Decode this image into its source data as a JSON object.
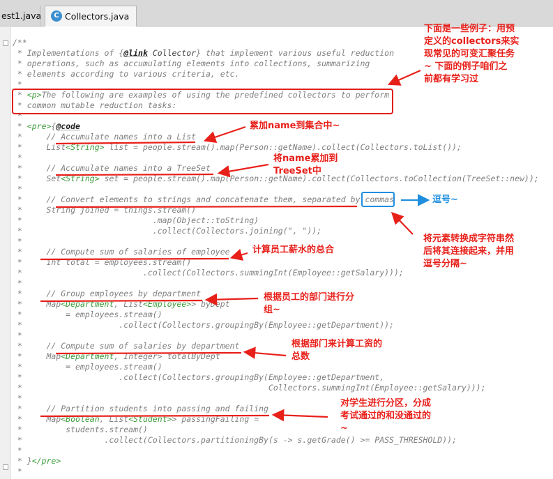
{
  "tabs": [
    {
      "label": "est1.java"
    },
    {
      "label": "Collectors.java",
      "icon": "C"
    }
  ],
  "code_lines": [
    {
      "id": 0,
      "parts": [
        {
          "t": "/**"
        }
      ]
    },
    {
      "id": 1,
      "parts": [
        {
          "t": " * Implementations of {"
        },
        {
          "t": "@link",
          "c": "kw"
        },
        {
          "t": " Collector",
          "c": "ref"
        },
        {
          "t": "} that implement various useful reduction"
        }
      ]
    },
    {
      "id": 2,
      "parts": [
        {
          "t": " * operations, such as accumulating elements into collections, summarizing"
        }
      ]
    },
    {
      "id": 3,
      "parts": [
        {
          "t": " * elements according to various criteria, etc."
        }
      ]
    },
    {
      "id": 4,
      "parts": [
        {
          "t": " *"
        }
      ]
    },
    {
      "id": 5,
      "parts": [
        {
          "t": " * "
        },
        {
          "t": "<p>",
          "c": "tag"
        },
        {
          "t": "The following are examples of using the predefined collectors to perform"
        }
      ]
    },
    {
      "id": 6,
      "parts": [
        {
          "t": " * common mutable reduction tasks:"
        }
      ]
    },
    {
      "id": 7,
      "parts": [
        {
          "t": " *"
        }
      ]
    },
    {
      "id": 8,
      "parts": [
        {
          "t": " * "
        },
        {
          "t": "<pre>",
          "c": "tag"
        },
        {
          "t": "{"
        },
        {
          "t": "@code",
          "c": "kw"
        }
      ]
    },
    {
      "id": 9,
      "parts": [
        {
          "t": " *     // Accumulate names into a List"
        }
      ]
    },
    {
      "id": 10,
      "parts": [
        {
          "t": " *     List"
        },
        {
          "t": "<String>",
          "c": "tag"
        },
        {
          "t": " list = people.stream().map(Person::getName).collect(Collectors.toList());"
        }
      ]
    },
    {
      "id": 11,
      "parts": [
        {
          "t": " *"
        }
      ]
    },
    {
      "id": 12,
      "parts": [
        {
          "t": " *     // Accumulate names into a TreeSet"
        }
      ]
    },
    {
      "id": 13,
      "parts": [
        {
          "t": " *     Set"
        },
        {
          "t": "<String>",
          "c": "tag"
        },
        {
          "t": " set = people.stream().map(Person::getName).collect(Collectors.toCollection(TreeSet::new));"
        }
      ]
    },
    {
      "id": 14,
      "parts": [
        {
          "t": " *"
        }
      ]
    },
    {
      "id": 15,
      "parts": [
        {
          "t": " *     // Convert elements to strings and concatenate them, separated by commas"
        }
      ]
    },
    {
      "id": 16,
      "parts": [
        {
          "t": " *     String joined = things.stream()"
        }
      ]
    },
    {
      "id": 17,
      "parts": [
        {
          "t": " *                           .map(Object::toString)"
        }
      ]
    },
    {
      "id": 18,
      "parts": [
        {
          "t": " *                           .collect(Collectors.joining(\", \"));"
        }
      ]
    },
    {
      "id": 19,
      "parts": [
        {
          "t": " *"
        }
      ]
    },
    {
      "id": 20,
      "parts": [
        {
          "t": " *     // Compute sum of salaries of employee"
        }
      ]
    },
    {
      "id": 21,
      "parts": [
        {
          "t": " *     int total = employees.stream()"
        }
      ]
    },
    {
      "id": 22,
      "parts": [
        {
          "t": " *                         .collect(Collectors.summingInt(Employee::getSalary)));"
        }
      ]
    },
    {
      "id": 23,
      "parts": [
        {
          "t": " *"
        }
      ]
    },
    {
      "id": 24,
      "parts": [
        {
          "t": " *     // Group employees by department"
        }
      ]
    },
    {
      "id": 25,
      "parts": [
        {
          "t": " *     Map"
        },
        {
          "t": "<Department",
          "c": "tag"
        },
        {
          "t": ", List"
        },
        {
          "t": "<Employee>",
          "c": "tag"
        },
        {
          "t": "> byDept"
        }
      ]
    },
    {
      "id": 26,
      "parts": [
        {
          "t": " *         = employees.stream()"
        }
      ]
    },
    {
      "id": 27,
      "parts": [
        {
          "t": " *                    .collect(Collectors.groupingBy(Employee::getDepartment));"
        }
      ]
    },
    {
      "id": 28,
      "parts": [
        {
          "t": " *"
        }
      ]
    },
    {
      "id": 29,
      "parts": [
        {
          "t": " *     // Compute sum of salaries by department"
        }
      ]
    },
    {
      "id": 30,
      "parts": [
        {
          "t": " *     Map"
        },
        {
          "t": "<Department",
          "c": "tag"
        },
        {
          "t": ", Integer> totalByDept"
        }
      ]
    },
    {
      "id": 31,
      "parts": [
        {
          "t": " *         = employees.stream()"
        }
      ]
    },
    {
      "id": 32,
      "parts": [
        {
          "t": " *                    .collect(Collectors.groupingBy(Employee::getDepartment,"
        }
      ]
    },
    {
      "id": 33,
      "parts": [
        {
          "t": " *                                                   Collectors.summingInt(Employee::getSalary)));"
        }
      ]
    },
    {
      "id": 34,
      "parts": [
        {
          "t": " *"
        }
      ]
    },
    {
      "id": 35,
      "parts": [
        {
          "t": " *     // Partition students into passing and failing"
        }
      ]
    },
    {
      "id": 36,
      "parts": [
        {
          "t": " *     Map"
        },
        {
          "t": "<Boolean",
          "c": "tag"
        },
        {
          "t": ", List"
        },
        {
          "t": "<Student>",
          "c": "tag"
        },
        {
          "t": "> passingFailing ="
        }
      ]
    },
    {
      "id": 37,
      "parts": [
        {
          "t": " *         students.stream()"
        }
      ]
    },
    {
      "id": 38,
      "parts": [
        {
          "t": " *                 .collect(Collectors.partitioningBy(s -> s.getGrade() >= PASS_THRESHOLD));"
        }
      ]
    },
    {
      "id": 39,
      "parts": [
        {
          "t": " *"
        }
      ]
    },
    {
      "id": 40,
      "parts": [
        {
          "t": " * }"
        },
        {
          "t": "</pre>",
          "c": "tag"
        }
      ]
    },
    {
      "id": 41,
      "parts": [
        {
          "t": " *"
        }
      ]
    }
  ],
  "annotations": {
    "intro": [
      "下面是一些例子：用预",
      "定义的collectors来实",
      "现常见的可变汇聚任务",
      "~  下面的例子咱们之",
      "前都有学习过"
    ],
    "to_list": "累加name到集合中~",
    "to_treeset": [
      "将name累加到",
      "TreeSet中"
    ],
    "comma": "逗号~",
    "joining": [
      "将元素转换成字符串然",
      "后将其连接起来，并用",
      "逗号分隔~"
    ],
    "sum": "计算员工薪水的总合",
    "group": [
      "根据员工的部门进行分",
      "组~"
    ],
    "sum_by_dept": [
      "根据部门来计算工资的",
      "总数"
    ],
    "partition": [
      "对学生进行分区，分成",
      "考试通过的和没通过的",
      "~"
    ]
  },
  "colors": {
    "annotation": "#e8201a",
    "annotation_blue": "#1e8fe0",
    "comment": "#7f7f7f",
    "tag": "#3c9c3c"
  }
}
